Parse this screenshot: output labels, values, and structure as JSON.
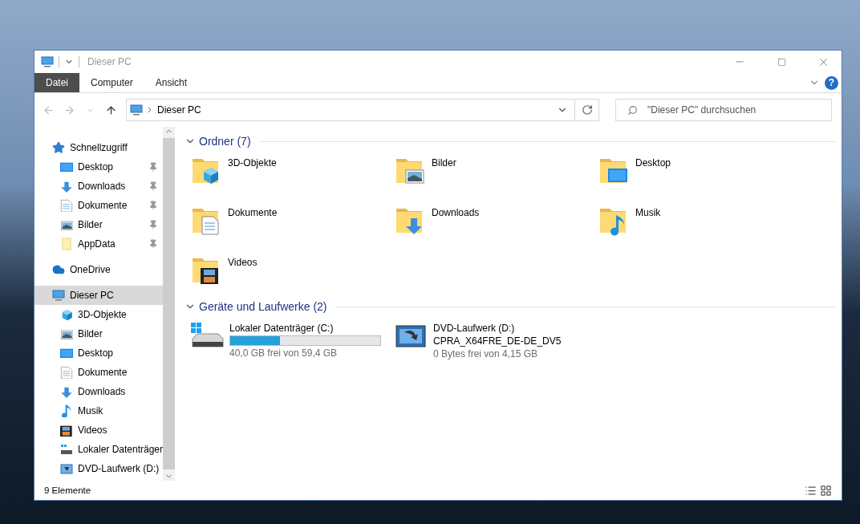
{
  "window": {
    "title": "Dieser PC"
  },
  "ribbon": {
    "tabs": [
      {
        "label": "Datei",
        "kind": "file",
        "selected": false
      },
      {
        "label": "Computer",
        "kind": "tab",
        "selected": false
      },
      {
        "label": "Ansicht",
        "kind": "tab",
        "selected": false
      }
    ],
    "help": "?"
  },
  "address_bar": {
    "path": "Dieser PC"
  },
  "search": {
    "placeholder": "\"Dieser PC\" durchsuchen"
  },
  "navigation": [
    {
      "label": "Schnellzugriff",
      "kind": "star",
      "selected": false,
      "children": [
        {
          "label": "Desktop",
          "kind": "desktop",
          "pinned": true,
          "selected": false
        },
        {
          "label": "Downloads",
          "kind": "downloads",
          "pinned": true,
          "selected": false
        },
        {
          "label": "Dokumente",
          "kind": "documents",
          "pinned": true,
          "selected": false
        },
        {
          "label": "Bilder",
          "kind": "pictures",
          "pinned": true,
          "selected": false
        },
        {
          "label": "AppData",
          "kind": "folder",
          "pinned": true,
          "selected": false
        }
      ]
    },
    {
      "label": "OneDrive",
      "kind": "cloud",
      "selected": false
    },
    {
      "label": "Dieser PC",
      "kind": "computer",
      "selected": true,
      "children": [
        {
          "label": "3D-Objekte",
          "kind": "objects3d",
          "pinned": false,
          "selected": false
        },
        {
          "label": "Bilder",
          "kind": "pictures",
          "pinned": false,
          "selected": false
        },
        {
          "label": "Desktop",
          "kind": "desktop",
          "pinned": false,
          "selected": false
        },
        {
          "label": "Dokumente",
          "kind": "documents",
          "pinned": false,
          "selected": false
        },
        {
          "label": "Downloads",
          "kind": "downloads",
          "pinned": false,
          "selected": false
        },
        {
          "label": "Musik",
          "kind": "music",
          "pinned": false,
          "selected": false
        },
        {
          "label": "Videos",
          "kind": "videos",
          "pinned": false,
          "selected": false
        },
        {
          "label": "Lokaler Datenträger",
          "kind": "drive",
          "pinned": false,
          "selected": false
        },
        {
          "label": "DVD-Laufwerk (D:)",
          "kind": "disc",
          "pinned": false,
          "selected": false
        }
      ]
    }
  ],
  "folders": {
    "title": "Ordner (7)",
    "items": [
      {
        "label": "3D-Objekte",
        "kind": "objects3d"
      },
      {
        "label": "Bilder",
        "kind": "pictures"
      },
      {
        "label": "Desktop",
        "kind": "desktop"
      },
      {
        "label": "Dokumente",
        "kind": "documents"
      },
      {
        "label": "Downloads",
        "kind": "downloads"
      },
      {
        "label": "Musik",
        "kind": "music"
      },
      {
        "label": "Videos",
        "kind": "videos"
      }
    ]
  },
  "drives": {
    "title": "Geräte und Laufwerke (2)",
    "items": [
      {
        "label": "Lokaler Datenträger (C:)",
        "kind": "drive",
        "level": 0.33,
        "free": "40,0 GB frei von 59,4 GB"
      },
      {
        "label": "DVD-Laufwerk (D:)",
        "volume": "CPRA_X64FRE_DE-DE_DV5",
        "kind": "disc",
        "free": "0 Bytes frei von 4,15 GB"
      }
    ]
  },
  "status_bar": {
    "count": "9 Elemente"
  }
}
